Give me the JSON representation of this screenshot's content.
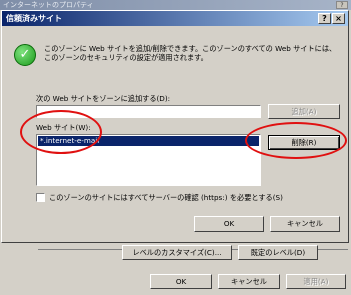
{
  "outer_window": {
    "title": "インターネットのプロパティ",
    "help_glyph": "?",
    "close_glyph": "×"
  },
  "dialog": {
    "title": "信頼済みサイト",
    "help_glyph": "?",
    "close_glyph": "×",
    "info_text": "このゾーンに Web サイトを追加/削除できます。このゾーンのすべての Web サイトには、このゾーンのセキュリティの設定が適用されます。",
    "add_label": "次の Web サイトをゾーンに追加する(D):",
    "add_input_value": "",
    "add_button": "追加(A)",
    "websites_label": "Web サイト(W):",
    "websites": [
      "*.internet-e-mail"
    ],
    "remove_button": "削除(R)",
    "https_checkbox_label": "このゾーンのサイトにはすべてサーバーの確認 (https:) を必要とする(S)",
    "https_checked": false,
    "ok_button": "OK",
    "cancel_button": "キャンセル"
  },
  "bottom": {
    "custom_level_button": "レベルのカスタマイズ(C)...",
    "default_level_button": "既定のレベル(D)",
    "ok_button": "OK",
    "cancel_button": "キャンセル",
    "apply_button": "適用(A)"
  },
  "colors": {
    "annotation": "#e01010",
    "selection": "#0a246a",
    "titlebar": "#0a246a"
  }
}
